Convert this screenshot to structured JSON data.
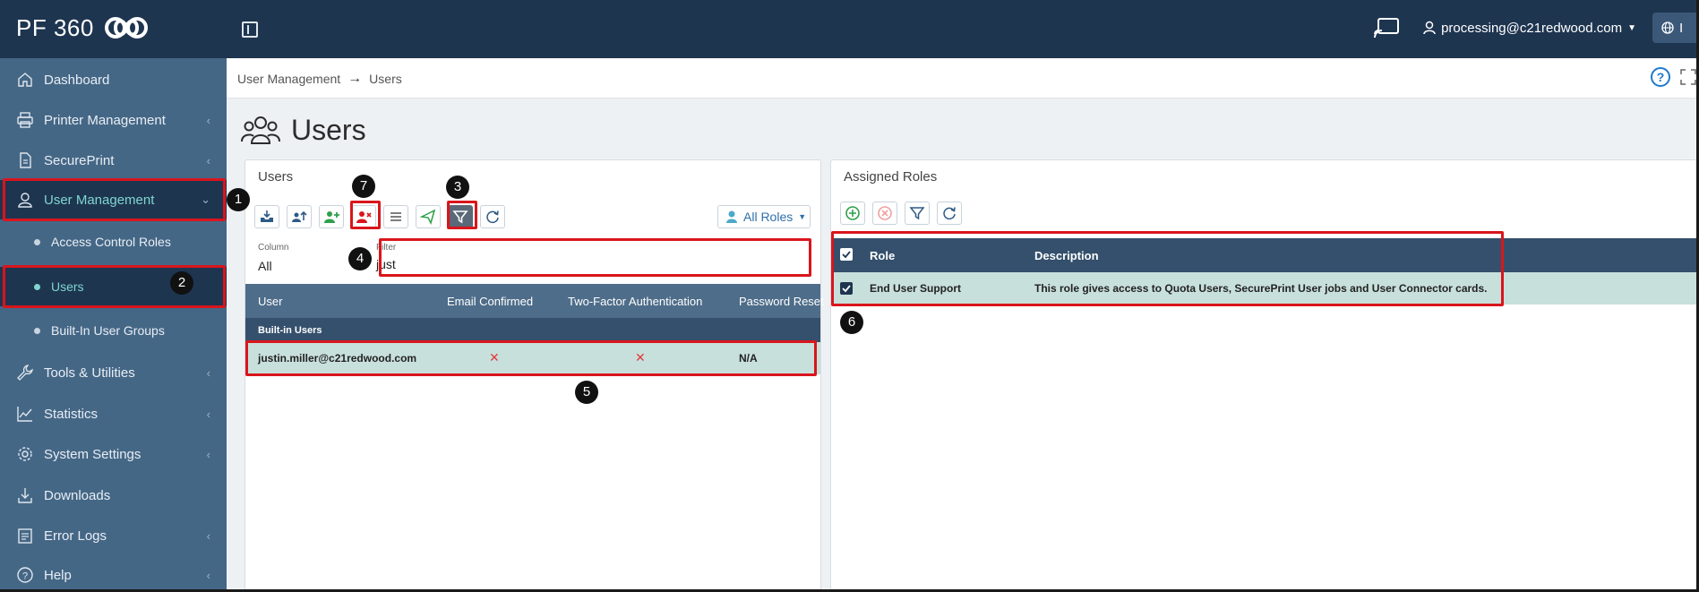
{
  "brand": {
    "name": "PF 360"
  },
  "header": {
    "user": "processing@c21redwood.com",
    "lang_short": "I"
  },
  "sidebar": {
    "items": [
      {
        "label": "Dashboard",
        "icon": "home-icon"
      },
      {
        "label": "Printer Management",
        "icon": "printer-icon",
        "chevron": "‹"
      },
      {
        "label": "SecurePrint",
        "icon": "document-icon",
        "chevron": "‹"
      },
      {
        "label": "User Management",
        "icon": "user-icon",
        "chevron": "⌄"
      },
      {
        "label": "Tools & Utilities",
        "icon": "wrench-icon",
        "chevron": "‹"
      },
      {
        "label": "Statistics",
        "icon": "chart-icon",
        "chevron": "‹"
      },
      {
        "label": "System Settings",
        "icon": "gear-icon",
        "chevron": "‹"
      },
      {
        "label": "Downloads",
        "icon": "download-icon"
      },
      {
        "label": "Error Logs",
        "icon": "log-icon",
        "chevron": "‹"
      },
      {
        "label": "Help",
        "icon": "help-icon",
        "chevron": "‹"
      }
    ],
    "sub_items": [
      {
        "label": "Access Control Roles"
      },
      {
        "label": "Users"
      },
      {
        "label": "Built-In User Groups"
      }
    ]
  },
  "breadcrumb": {
    "parent": "User Management",
    "arrow": "→",
    "current": "Users"
  },
  "help_glyph": "?",
  "page": {
    "title": "Users"
  },
  "users_panel": {
    "title": "Users",
    "roles_dropdown": "All Roles",
    "filter": {
      "column_label": "Column",
      "column_value": "All",
      "filter_label": "Filter",
      "filter_value": "just"
    },
    "columns": [
      "User",
      "Email Confirmed",
      "Two-Factor Authentication",
      "Password Reset"
    ],
    "group": "Built-in Users",
    "rows": [
      {
        "user": "justin.miller@c21redwood.com",
        "email_confirmed": "✕",
        "two_factor": "✕",
        "password_reset": "N/A"
      }
    ]
  },
  "roles_panel": {
    "title": "Assigned Roles",
    "columns": [
      "Role",
      "Description"
    ],
    "rows": [
      {
        "role": "End User Support",
        "description": "This role gives access to Quota Users, SecurePrint User jobs and User Connector cards."
      }
    ]
  },
  "callouts": [
    "1",
    "2",
    "3",
    "4",
    "5",
    "6",
    "7"
  ],
  "colors": {
    "topbar": "#1e3550",
    "sidebar": "#456786",
    "accent": "#7fd6cf",
    "annotation_red": "#d9151c"
  }
}
